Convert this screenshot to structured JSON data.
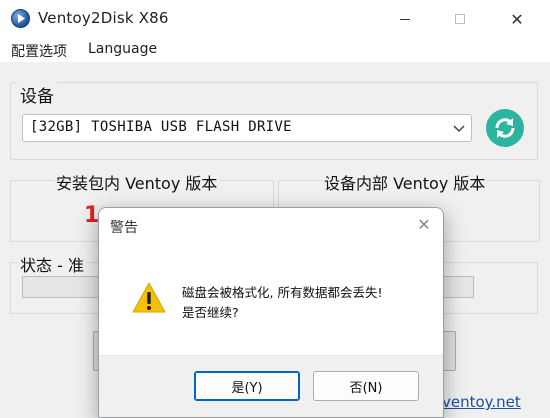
{
  "window": {
    "title": "Ventoy2Disk  X86",
    "minimize_icon": "minimize-icon",
    "maximize_icon": "maximize-icon",
    "close_icon": "close-icon",
    "close_glyph": "✕"
  },
  "menu": {
    "items": [
      {
        "label": "配置选项"
      },
      {
        "label": "Language"
      }
    ]
  },
  "device": {
    "group_label": "设备",
    "selected": "[32GB] TOSHIBA USB FLASH DRIVE",
    "refresh_icon": "refresh-icon"
  },
  "versions": {
    "package_title": "安装包内 Ventoy 版本",
    "package_value": "1.  .   ",
    "device_title": "设备内部 Ventoy 版本"
  },
  "status": {
    "label": "状态 - 准",
    "progress": 0
  },
  "footer": {
    "link": "ventoy.net"
  },
  "dialog": {
    "title": "警告",
    "close_glyph": "✕",
    "message_line1": "磁盘会被格式化, 所有数据都会丢失!",
    "message_line2": "是否继续?",
    "yes_label": "是(Y)",
    "no_label": "否(N)",
    "icon": "warning-icon"
  },
  "colors": {
    "accent": "#0067c0",
    "refresh": "#2bb5a0",
    "version_red": "#e02020",
    "warning": "#f5c000"
  }
}
